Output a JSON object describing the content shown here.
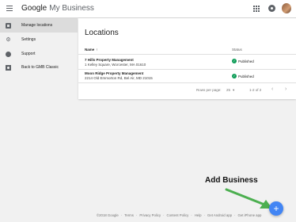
{
  "header": {
    "brand_google": "Google",
    "brand_product": "My Business"
  },
  "sidebar": {
    "items": [
      {
        "label": "Manage locations",
        "icon": "store-icon",
        "active": true
      },
      {
        "label": "Settings",
        "icon": "gear-icon",
        "active": false
      },
      {
        "label": "Support",
        "icon": "help-icon",
        "active": false
      },
      {
        "label": "Back to GMB Classic",
        "icon": "back-icon",
        "active": false
      }
    ]
  },
  "main": {
    "title": "Locations",
    "columns": {
      "name": "Name",
      "sort_arrow": "↑",
      "status": "Status"
    },
    "rows": [
      {
        "name": "7 Hills Property Management",
        "address": "1 Kelley Square, Worcester, MA 01610",
        "status": "Published"
      },
      {
        "name": "Moon Ridge Property Management",
        "address": "2214 Old Emmorton Rd, Bel Air, MD 21015",
        "status": "Published"
      }
    ],
    "pagination": {
      "rows_per_page_label": "Rows per page:",
      "rows_per_page_value": "25",
      "range": "1-2 of 2"
    }
  },
  "annotation": {
    "text": "Add Business"
  },
  "fab": {
    "label": "+"
  },
  "footer": {
    "copyright": "©2018 Google",
    "links": [
      "Terms",
      "Privacy Policy",
      "Content Policy",
      "Help",
      "Get Android app",
      "Get iPhone app"
    ]
  },
  "colors": {
    "accent": "#4285f4",
    "published": "#0f9d58",
    "arrow": "#4caf50"
  }
}
